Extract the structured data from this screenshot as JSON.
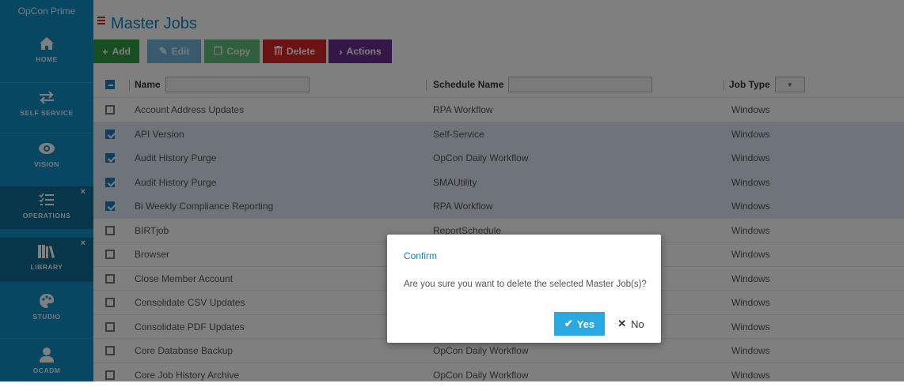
{
  "app": {
    "title": "OpCon Prime"
  },
  "sidebar": {
    "items": [
      {
        "label": "HOME",
        "icon": "home-icon"
      },
      {
        "label": "SELF SERVICE",
        "icon": "arrows-exchange-icon"
      },
      {
        "label": "VISION",
        "icon": "eye-icon"
      },
      {
        "label": "OPERATIONS",
        "icon": "checklist-icon",
        "closable": true
      },
      {
        "label": "LIBRARY",
        "icon": "books-icon",
        "closable": true,
        "active": true
      },
      {
        "label": "STUDIO",
        "icon": "palette-icon"
      },
      {
        "label": "OCADM",
        "icon": "user-icon"
      }
    ],
    "close_glyph": "×"
  },
  "page": {
    "title": "Master Jobs"
  },
  "toolbar": {
    "add": "Add",
    "edit": "Edit",
    "copy": "Copy",
    "delete": "Delete",
    "actions": "Actions"
  },
  "table": {
    "columns": [
      "Name",
      "Schedule Name",
      "Job Type"
    ],
    "rows": [
      {
        "name": "Account Address Updates",
        "schedule": "RPA Workflow",
        "type": "Windows",
        "checked": false
      },
      {
        "name": "API Version",
        "schedule": "Self-Service",
        "type": "Windows",
        "checked": true
      },
      {
        "name": "Audit History Purge",
        "schedule": "OpCon Daily Workflow",
        "type": "Windows",
        "checked": true
      },
      {
        "name": "Audit History Purge",
        "schedule": "SMAUtility",
        "type": "Windows",
        "checked": true
      },
      {
        "name": "Bi Weekly Compliance Reporting",
        "schedule": "RPA Workflow",
        "type": "Windows",
        "checked": true
      },
      {
        "name": "BIRTjob",
        "schedule": "ReportSchedule",
        "type": "Windows",
        "checked": false
      },
      {
        "name": "Browser",
        "schedule": "",
        "type": "Windows",
        "checked": false
      },
      {
        "name": "Close Member Account",
        "schedule": "",
        "type": "Windows",
        "checked": false
      },
      {
        "name": "Consolidate CSV Updates",
        "schedule": "",
        "type": "Windows",
        "checked": false
      },
      {
        "name": "Consolidate PDF Updates",
        "schedule": "",
        "type": "Windows",
        "checked": false
      },
      {
        "name": "Core Database Backup",
        "schedule": "OpCon Daily Workflow",
        "type": "Windows",
        "checked": false
      },
      {
        "name": "Core Job History Archive",
        "schedule": "OpCon Daily Workflow",
        "type": "Windows",
        "checked": false
      }
    ]
  },
  "dialog": {
    "title": "Confirm",
    "message": "Are you sure you want to delete the selected Master Job(s)?",
    "yes": "Yes",
    "no": "No"
  },
  "colors": {
    "sidebar": "#0f8fc3",
    "sidebar_active": "#0e6b94",
    "title": "#1284b8",
    "add": "#2f9c43",
    "delete": "#d62626",
    "actions": "#6a2c91",
    "yes": "#2aa8e0"
  }
}
